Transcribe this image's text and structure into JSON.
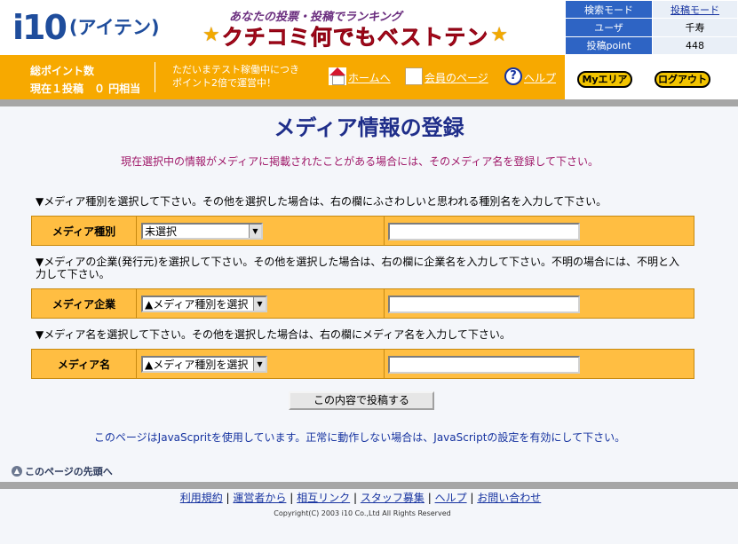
{
  "header": {
    "logo_mark": "i10",
    "logo_kana": "(アイテン)",
    "tagline": "あなたの投票・投稿でランキング",
    "banner_title": "クチコミ何でもベストテン",
    "banner_star": "★",
    "info": {
      "search_mode": "検索モード",
      "post_mode": "投稿モード",
      "user_label": "ユーザ",
      "user_value": "千寿",
      "points_label": "投稿point",
      "points_value": "448"
    },
    "points_line1": "総ポイント数",
    "points_line2": "現在１投稿　０ 円相当",
    "notice_line1": "ただいまテスト稼働中につき",
    "notice_line2": "ポイント2倍で運営中！",
    "nav": {
      "home": "ホームへ",
      "member": "会員のページ",
      "help": "ヘルプ",
      "help_glyph": "?"
    },
    "my_area": "Myエリア",
    "logout": "ログアウト"
  },
  "main": {
    "title": "メディア情報の登録",
    "subtitle": "現在選択中の情報がメディアに掲載されたことがある場合には、そのメディア名を登録して下さい。",
    "instr_type": "▼メディア種別を選択して下さい。その他を選択した場合は、右の欄にふさわしいと思われる種別名を入力して下さい。",
    "instr_company_1": "▼メディアの企業(発行元)を選択して下さい。その他を選択した場合は、右の欄に企業名を入力して下さい。不明の場合には、不明と入",
    "instr_company_2": "力して下さい。",
    "instr_name": "▼メディア名を選択して下さい。その他を選択した場合は、右の欄にメディア名を入力して下さい。",
    "rows": [
      {
        "label": "メディア種別",
        "select_value": "未選択",
        "text_value": ""
      },
      {
        "label": "メディア企業",
        "select_value": "▲メディア種別を選択",
        "text_value": ""
      },
      {
        "label": "メディア名",
        "select_value": "▲メディア種別を選択",
        "text_value": ""
      }
    ],
    "select_arrow": "▼",
    "submit": "この内容で投稿する",
    "js_note": "このページはJavaScpritを使用しています。正常に動作しない場合は、JavaScriptの設定を有効にして下さい。"
  },
  "footer": {
    "back_to_top": "このページの先頭へ",
    "back_glyph": "▲",
    "links": [
      "利用規約",
      "運営者から",
      "相互リンク",
      "スタッフ募集",
      "ヘルプ",
      "お問い合わせ"
    ],
    "separator": "|",
    "copyright": "Copyright(C) 2003 i10 Co.,Ltd All Rights Reserved"
  },
  "colors": {
    "brand_blue": "#1f4d9c",
    "orange": "#f7a900",
    "form_orange": "#ffbe42",
    "title_navy": "#1f2e8a",
    "subtitle_magenta": "#a01a6a",
    "link_blue": "#1633a0",
    "banner_red": "#d4172f"
  }
}
